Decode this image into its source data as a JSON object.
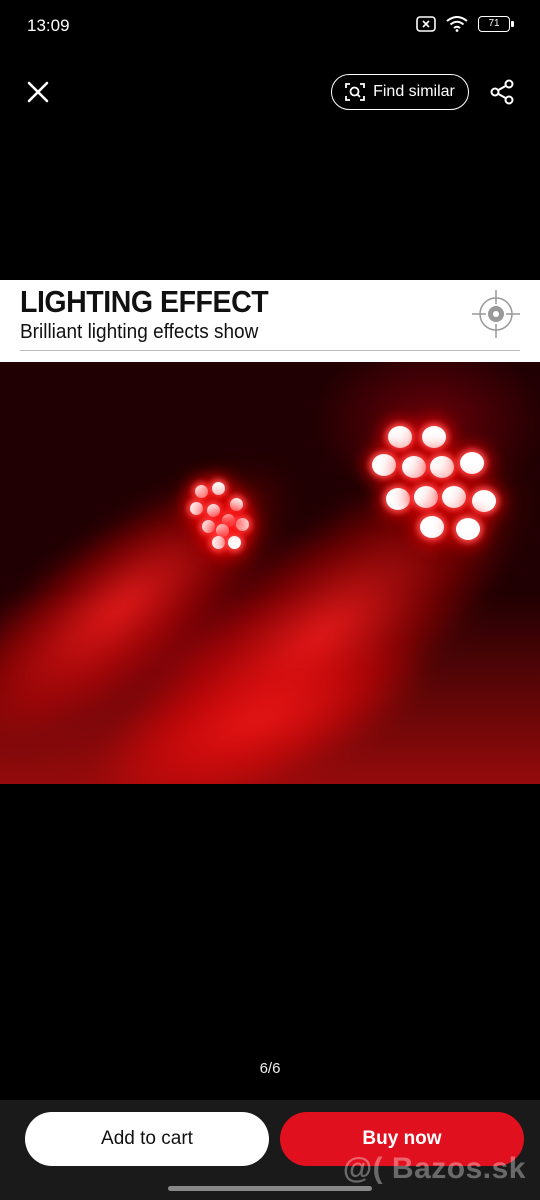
{
  "status_bar": {
    "time": "13:09",
    "battery": "71"
  },
  "top_bar": {
    "find_similar_label": "Find similar"
  },
  "product_image": {
    "banner_title": "LIGHTING EFFECT",
    "banner_subtitle": "Brilliant lighting effects show"
  },
  "gallery": {
    "page_indicator": "6/6"
  },
  "actions": {
    "add_to_cart_label": "Add to cart",
    "buy_now_label": "Buy now"
  },
  "watermark": "@( Bazos.sk",
  "colors": {
    "buy_now": "#e0101f",
    "background": "#000000",
    "bottom_bar": "#1a1a1a"
  },
  "icons": [
    "close-icon",
    "scan-icon",
    "share-icon",
    "wifi-icon",
    "battery-icon",
    "target-icon"
  ]
}
